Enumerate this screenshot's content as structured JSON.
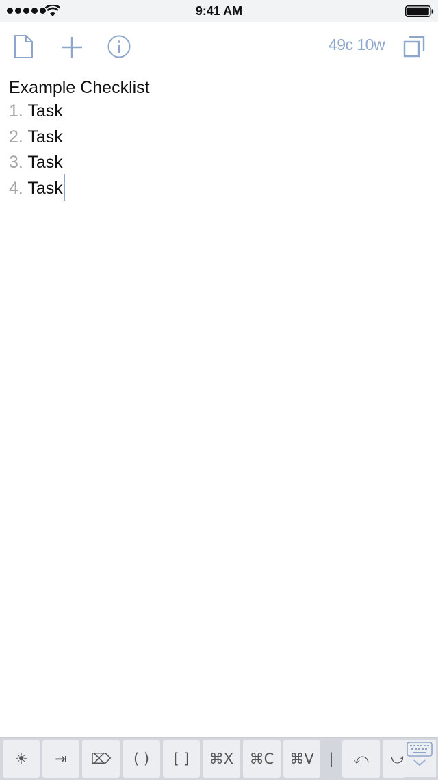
{
  "status_bar": {
    "time": "9:41 AM"
  },
  "toolbar": {
    "counter": "49c 10w"
  },
  "editor": {
    "title": "Example Checklist",
    "items": [
      {
        "number": "1.",
        "text": "Task"
      },
      {
        "number": "2.",
        "text": "Task"
      },
      {
        "number": "3.",
        "text": "Task"
      },
      {
        "number": "4.",
        "text": "Task"
      }
    ]
  },
  "keyboard_bar": {
    "keys": {
      "brightness": "☀",
      "tab": "⇥",
      "delete": "⌦",
      "parens": "( )",
      "brackets": "[ ]",
      "cut": "⌘X",
      "copy": "⌘C",
      "paste": "⌘V",
      "pipe": "|",
      "undo": "⤺",
      "redo": "⤻"
    }
  },
  "colors": {
    "accent": "#8fa6cc",
    "status_bar_bg": "#f1f3f5",
    "keyboard_bg": "#d3d7dd"
  }
}
